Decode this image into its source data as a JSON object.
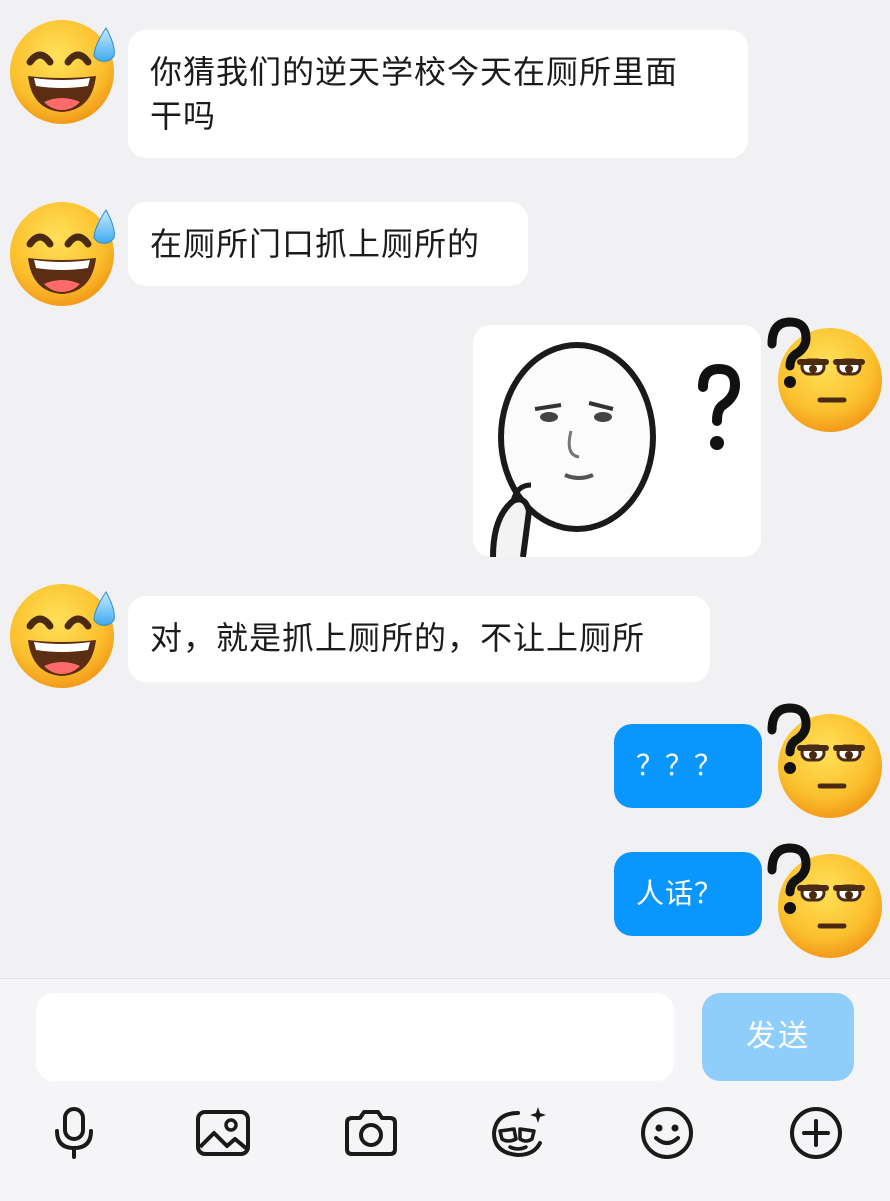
{
  "messages": [
    {
      "from": "other",
      "text": "你猜我们的逆天学校今天在厕所里面干吗",
      "line1": "你猜我们的逆天学校今天在厕所里面",
      "line2": "干吗"
    },
    {
      "from": "other",
      "text": "在厕所门口抓上厕所的"
    },
    {
      "from": "me",
      "type": "sticker",
      "sticker": "confused-face-question-mark"
    },
    {
      "from": "other",
      "text": "对，就是抓上厕所的，不让上厕所"
    },
    {
      "from": "me",
      "text": "？？？"
    },
    {
      "from": "me",
      "text": "人话？"
    }
  ],
  "avatars": {
    "other": "sweat-smile-emoji",
    "me": "unamused-question-emoji"
  },
  "input": {
    "value": "",
    "placeholder": ""
  },
  "send_label": "发送",
  "toolbar": [
    "microphone-icon",
    "image-icon",
    "camera-icon",
    "sticker-edit-icon",
    "emoji-icon",
    "plus-icon"
  ],
  "colors": {
    "background": "#f1f1f3",
    "outgoing_bubble": "#0a96ff",
    "incoming_bubble": "#ffffff",
    "send_button_disabled": "#8fcdfb"
  }
}
